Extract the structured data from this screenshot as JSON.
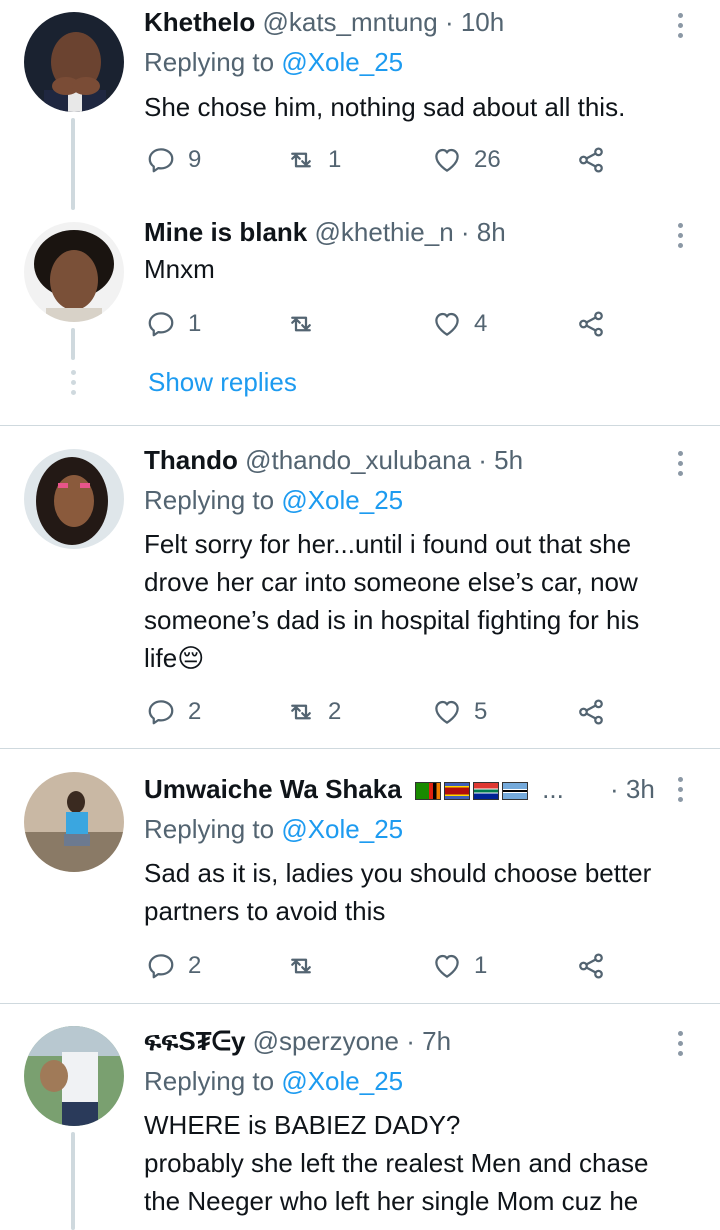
{
  "tweets": [
    {
      "name": "Khethelo",
      "handle": "@kats_mntung",
      "time": "· 10h",
      "replying_prefix": "Replying to ",
      "replying_to": "@Xole_25",
      "text": "She chose him, nothing sad about all this.",
      "replies": "9",
      "retweets": "1",
      "likes": "26"
    },
    {
      "name": "Mine is blank",
      "handle": "@khethie_n",
      "time": "· 8h",
      "text": "Mnxm",
      "replies": "1",
      "retweets": "",
      "likes": "4",
      "show_replies": "Show replies"
    },
    {
      "name": "Thando",
      "handle": "@thando_xulubana",
      "time": "· 5h",
      "replying_prefix": "Replying to ",
      "replying_to": "@Xole_25",
      "text_lines": [
        "Felt sorry for her...until i found out that she",
        "drove her car into someone else’s car, now",
        "someone’s dad is in hospital fighting for his",
        "life😔"
      ],
      "replies": "2",
      "retweets": "2",
      "likes": "5"
    },
    {
      "name": "Umwaiche Wa Shaka",
      "name_suffix": "...",
      "handle": "",
      "time": "· 3h",
      "replying_prefix": "Replying to ",
      "replying_to": "@Xole_25",
      "text_lines": [
        "Sad as it is, ladies you should choose better",
        "partners to avoid this"
      ],
      "replies": "2",
      "retweets": "",
      "likes": "1"
    },
    {
      "name": "ፍፍS₮ᕮy",
      "handle": "@sperzyone",
      "time": "· 7h",
      "replying_prefix": "Replying to ",
      "replying_to": "@Xole_25",
      "text_lines": [
        "WHERE is BABIEZ DADY?",
        "probably she left the realest Men and chase",
        "the Neeger who left her single Mom cuz he"
      ]
    }
  ],
  "icons": {
    "reply": "reply-icon",
    "retweet": "retweet-icon",
    "like": "heart-icon",
    "share": "share-icon",
    "more": "more-vertical-icon"
  },
  "colors": {
    "link": "#1d9bf0",
    "secondary_text": "#536471",
    "divider": "#cfd9de"
  }
}
